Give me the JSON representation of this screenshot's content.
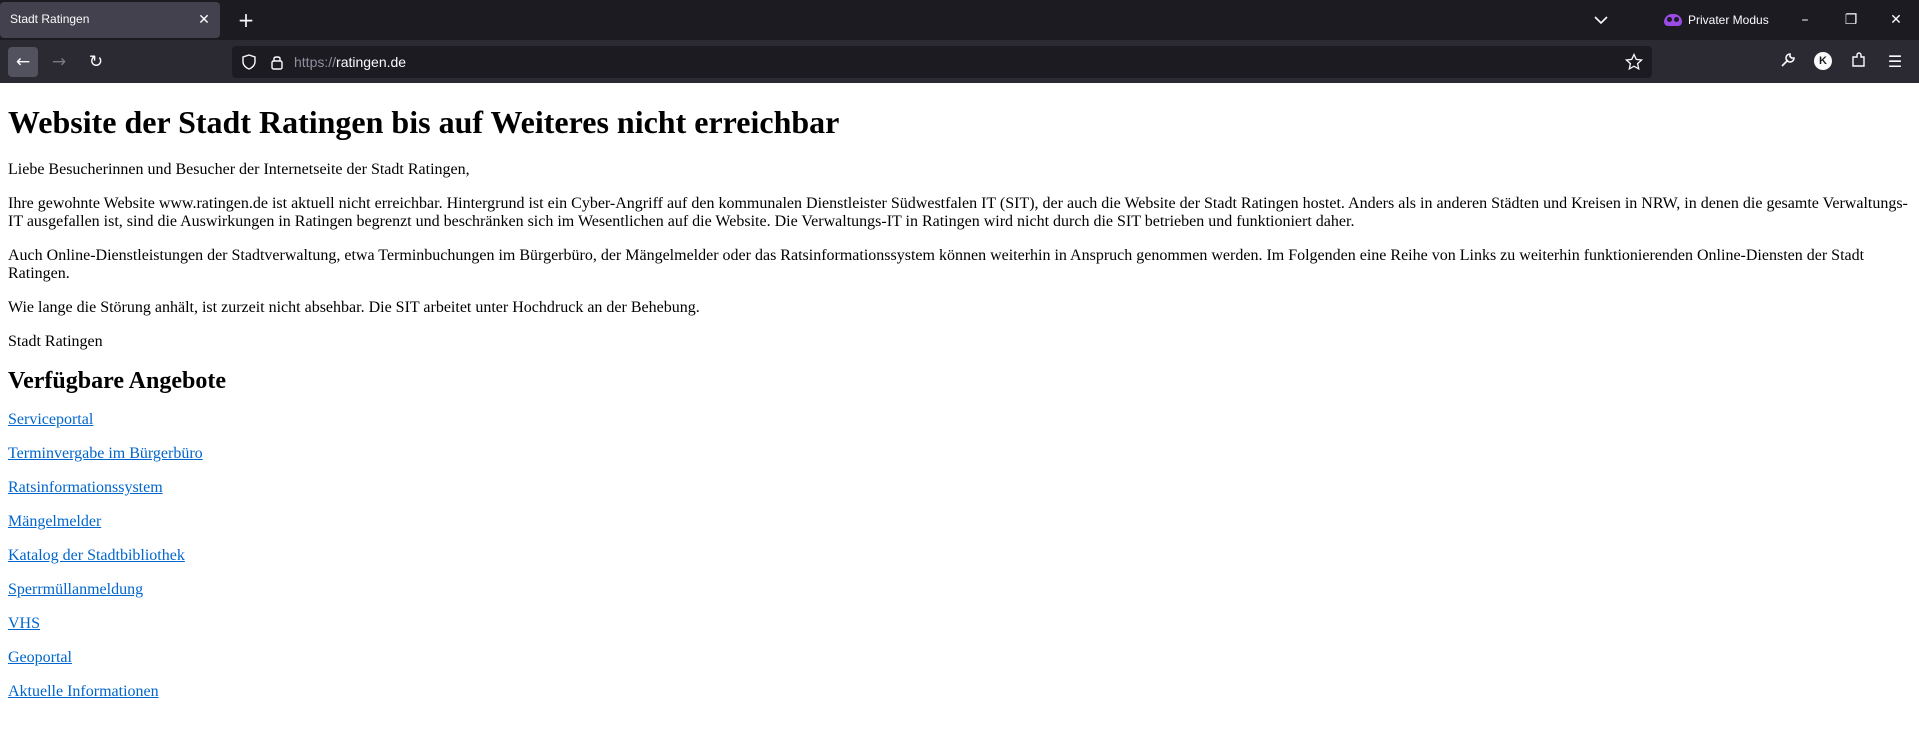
{
  "browser": {
    "tab_title": "Stadt Ratingen",
    "private_mode_label": "Privater Modus",
    "url_scheme": "https://",
    "url_host": "ratingen.de",
    "account_initial": "K"
  },
  "page": {
    "heading": "Website der Stadt Ratingen bis auf Weiteres nicht erreichbar",
    "greeting": "Liebe Besucherinnen und Besucher der Internetseite der Stadt Ratingen,",
    "paragraph1": "Ihre gewohnte Website www.ratingen.de ist aktuell nicht erreichbar. Hintergrund ist ein Cyber-Angriff auf den kommunalen Dienstleister Südwestfalen IT (SIT), der auch die Website der Stadt Ratingen hostet. Anders als in anderen Städten und Kreisen in NRW, in denen die gesamte Verwaltungs-IT ausgefallen ist, sind die Auswirkungen in Ratingen begrenzt und beschränken sich im Wesentlichen auf die Website. Die Verwaltungs-IT in Ratingen wird nicht durch die SIT betrieben und funktioniert daher.",
    "paragraph2": "Auch Online-Dienstleistungen der Stadtverwaltung, etwa Terminbuchungen im Bürgerbüro, der Mängelmelder oder das Ratsinformationssystem können weiterhin in Anspruch genommen werden. Im Folgenden eine Reihe von Links zu weiterhin funktionierenden Online-Diensten der Stadt Ratingen.",
    "paragraph3": "Wie lange die Störung anhält, ist zurzeit nicht absehbar. Die SIT arbeitet unter Hochdruck an der Behebung.",
    "signature": "Stadt Ratingen",
    "subheading": "Verfügbare Angebote",
    "links": [
      "Serviceportal",
      "Terminvergabe im Bürgerbüro",
      "Ratsinformationssystem",
      "Mängelmelder",
      "Katalog der Stadtbibliothek",
      "Sperrmüllanmeldung",
      "VHS",
      "Geoportal",
      "Aktuelle Informationen"
    ],
    "link_color": "#0066cc"
  }
}
